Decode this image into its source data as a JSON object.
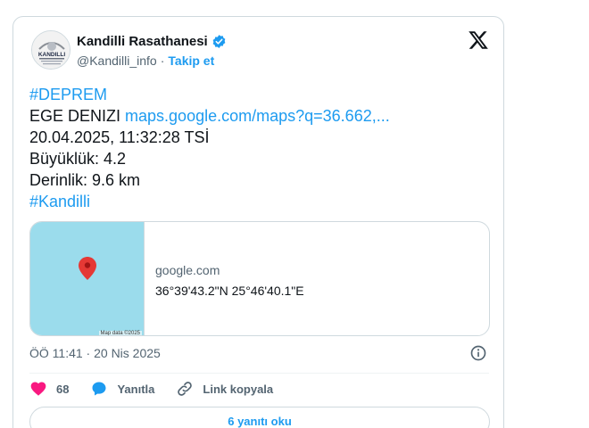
{
  "author": {
    "name": "Kandilli Rasathanesi",
    "handle": "@Kandilli_info",
    "separator": "·",
    "follow_label": "Takip et",
    "avatar_text": "KANDILLI"
  },
  "tweet": {
    "hashtag1": "#DEPREM",
    "location": "EGE DENIZI",
    "map_link": "maps.google.com/maps?q=36.662,...",
    "datetime": "20.04.2025, 11:32:28 TSİ",
    "magnitude": "Büyüklük: 4.2",
    "depth": "Derinlik: 9.6 km",
    "hashtag2": "#Kandilli"
  },
  "link_card": {
    "domain": "google.com",
    "coordinates": "36°39'43.2\"N 25°46'40.1\"E",
    "map_attribution": "Map data ©2025",
    "map_color": "#9bdcec",
    "pin_color": "#e53935"
  },
  "meta": {
    "timestamp": "ÖÖ 11:41 · 20 Nis 2025"
  },
  "actions": {
    "like_count": "68",
    "reply_label": "Yanıtla",
    "copy_link_label": "Link kopyala"
  },
  "replies_button": "6 yanıtı oku",
  "colors": {
    "accent": "#1d9bf0",
    "like": "#f91880",
    "text": "#0f1419",
    "muted": "#536471"
  }
}
